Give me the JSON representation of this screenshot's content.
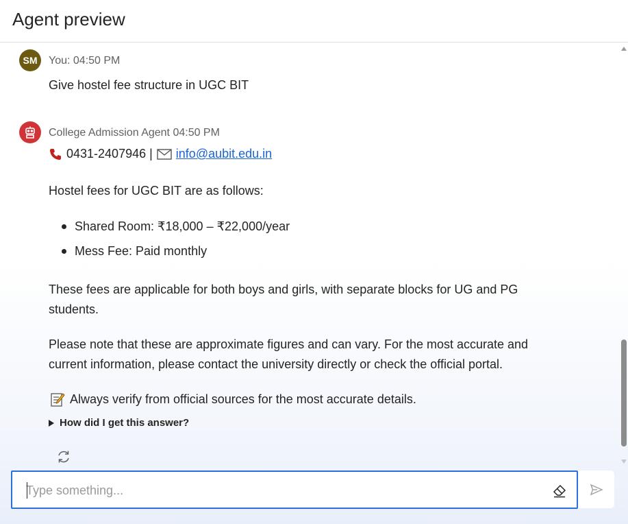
{
  "header": {
    "title": "Agent preview"
  },
  "conversation": {
    "user_message": {
      "avatar_initials": "SM",
      "avatar_color": "#6b5a10",
      "meta": "You: 04:50 PM",
      "text": "Give hostel fee structure in UGC BIT"
    },
    "agent_message": {
      "avatar_icon": "robot-icon",
      "avatar_color": "#d13438",
      "meta": "College Admission Agent 04:50 PM",
      "phone": "0431-2407946 |",
      "email": "info@aubit.edu.in",
      "intro": "Hostel fees for UGC BIT are as follows:",
      "fee_items": [
        "Shared Room: ₹18,000 – ₹22,000/year",
        "Mess Fee: Paid monthly"
      ],
      "para1": "These fees are applicable for both boys and girls, with separate blocks for UG and PG students.",
      "para2": "Please note that these are approximate figures and can vary. For the most accurate and current information, please contact the university directly or check the official portal.",
      "note": "Always verify from official sources for the most accurate details.",
      "details_label": "How did I get this answer?"
    }
  },
  "composer": {
    "placeholder": "Type something...",
    "accent_color": "#2a6fdb"
  }
}
